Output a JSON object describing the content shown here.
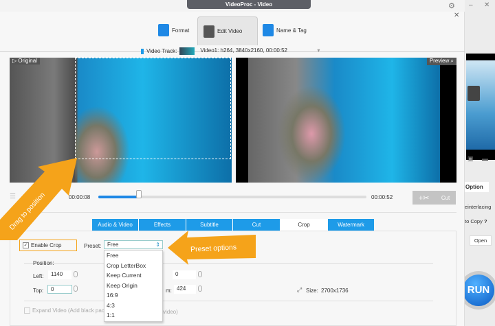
{
  "window": {
    "title": "VideoProc - Video"
  },
  "tabs": [
    {
      "label": "Format"
    },
    {
      "label": "Edit Video"
    },
    {
      "label": "Name & Tag"
    }
  ],
  "video_track": {
    "label": "Video Track:",
    "value": "Video1: h264, 3840x2160, 00:00:52"
  },
  "panes": {
    "original": "Original",
    "preview": "Preview"
  },
  "timeline": {
    "current": "00:00:08",
    "total": "00:00:52",
    "progress": 0.15,
    "cut_label": "Cut"
  },
  "edit_tabs": [
    "Audio & Video",
    "Effects",
    "Subtitle",
    "Cut",
    "Crop",
    "Watermark"
  ],
  "crop": {
    "enable_label": "Enable Crop",
    "enabled": true,
    "preset_label": "Preset:",
    "preset_value": "Free",
    "preset_options": [
      "Free",
      "Crop LetterBox",
      "Keep Current",
      "Keep Origin",
      "16:9",
      "4:3",
      "1:1"
    ],
    "position_label": "Position:",
    "left_label": "Left:",
    "left_value": "1140",
    "top_label": "Top:",
    "top_value": "0",
    "right_value": "0",
    "bottom_label_partial": "m:",
    "bottom_value": "424",
    "size_label": "Size:",
    "size_value": "2700x1736",
    "expand_label_a": "Expand Video (Add black pac",
    "expand_label_b": "video)"
  },
  "annotations": {
    "drag": "Drag to position",
    "preset": "Preset options"
  },
  "background_app": {
    "option": "Option",
    "deinterlacing": "einterlacing",
    "copy": "to Copy",
    "help": "?",
    "open": "Open",
    "run": "RUN"
  }
}
